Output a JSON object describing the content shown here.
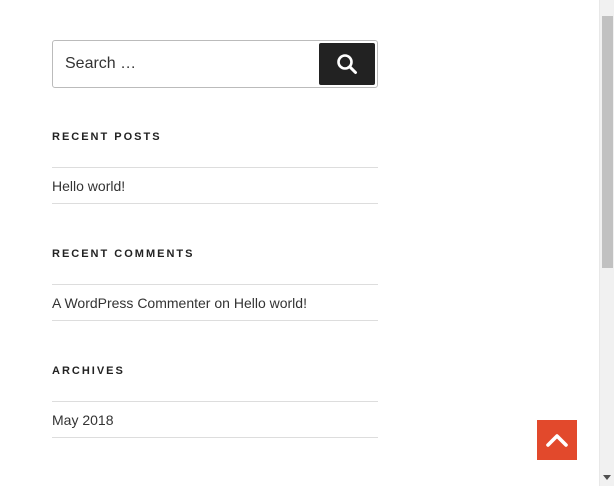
{
  "search": {
    "placeholder": "Search …",
    "button_icon": "search-icon"
  },
  "widgets": {
    "recent_posts": {
      "title": "Recent Posts",
      "items": [
        {
          "label": "Hello world!"
        }
      ]
    },
    "recent_comments": {
      "title": "Recent Comments",
      "items": [
        {
          "author": "A WordPress Commenter",
          "connector": "on",
          "post": "Hello world!"
        }
      ]
    },
    "archives": {
      "title": "Archives",
      "items": [
        {
          "label": "May 2018"
        }
      ]
    }
  },
  "scroll_to_top": {
    "icon": "chevron-up-icon",
    "color": "#e2492c"
  },
  "colors": {
    "text": "#222222",
    "button_dark": "#222222",
    "divider": "#dddddd",
    "accent": "#e2492c"
  }
}
